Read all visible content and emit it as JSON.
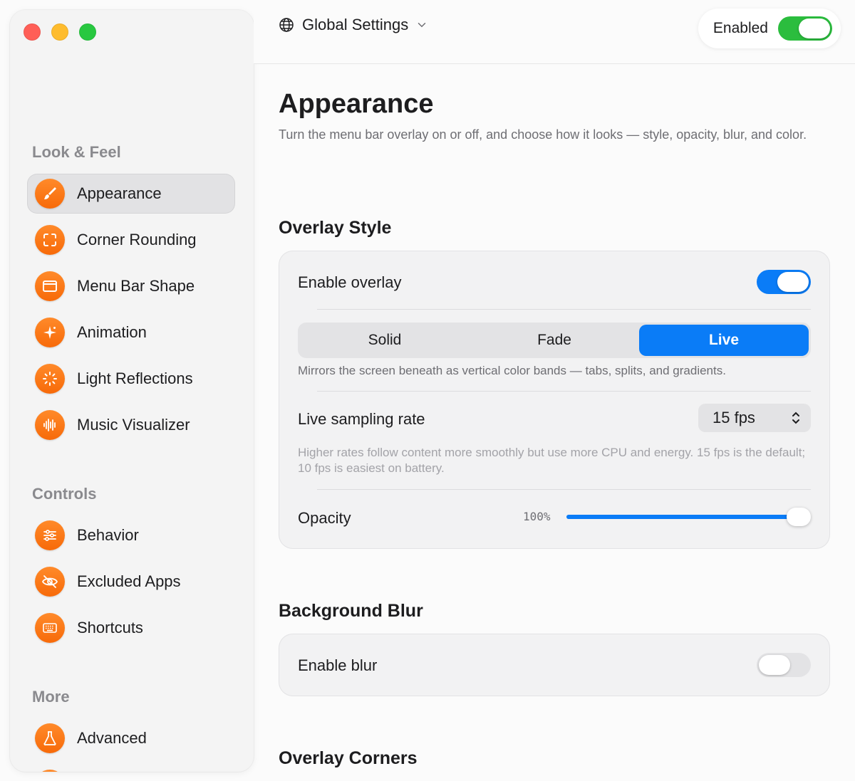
{
  "window": {
    "header": {
      "scope_label": "Global Settings",
      "enabled_label": "Enabled",
      "enabled_on": true
    }
  },
  "sidebar": {
    "sections": [
      {
        "title": "Look & Feel",
        "items": [
          {
            "label": "Appearance",
            "icon": "paintbrush-icon",
            "active": true
          },
          {
            "label": "Corner Rounding",
            "icon": "corners-icon"
          },
          {
            "label": "Menu Bar Shape",
            "icon": "menubar-shape-icon"
          },
          {
            "label": "Animation",
            "icon": "sparkles-icon"
          },
          {
            "label": "Light Reflections",
            "icon": "light-rays-icon"
          },
          {
            "label": "Music Visualizer",
            "icon": "waveform-icon"
          }
        ]
      },
      {
        "title": "Controls",
        "items": [
          {
            "label": "Behavior",
            "icon": "sliders-icon"
          },
          {
            "label": "Excluded Apps",
            "icon": "eye-slash-icon"
          },
          {
            "label": "Shortcuts",
            "icon": "keyboard-icon"
          }
        ]
      },
      {
        "title": "More",
        "items": [
          {
            "label": "Advanced",
            "icon": "flask-icon"
          }
        ]
      }
    ]
  },
  "main": {
    "title": "Appearance",
    "description": "Turn the menu bar overlay on or off, and choose how it looks — style, opacity, blur, and color.",
    "overlay_style": {
      "title": "Overlay Style",
      "enable_overlay_label": "Enable overlay",
      "enable_overlay_on": true,
      "modes": [
        "Solid",
        "Fade",
        "Live"
      ],
      "selected_mode": "Live",
      "mode_hint": "Mirrors the screen beneath as vertical color bands — tabs, splits, and gradients.",
      "sampling_label": "Live sampling rate",
      "sampling_value": "15 fps",
      "sampling_hint": "Higher rates follow content more smoothly but use more CPU and energy. 15 fps is the default; 10 fps is easiest on battery.",
      "opacity_label": "Opacity",
      "opacity_value_text": "100%",
      "opacity_fraction": 1.0
    },
    "background_blur": {
      "title": "Background Blur",
      "enable_blur_label": "Enable blur",
      "enable_blur_on": false
    },
    "overlay_corners": {
      "title": "Overlay Corners"
    }
  },
  "colors": {
    "accent": "#0a7cf7",
    "icon_orange": "#f76a09",
    "enabled_green": "#2bbd3e"
  }
}
